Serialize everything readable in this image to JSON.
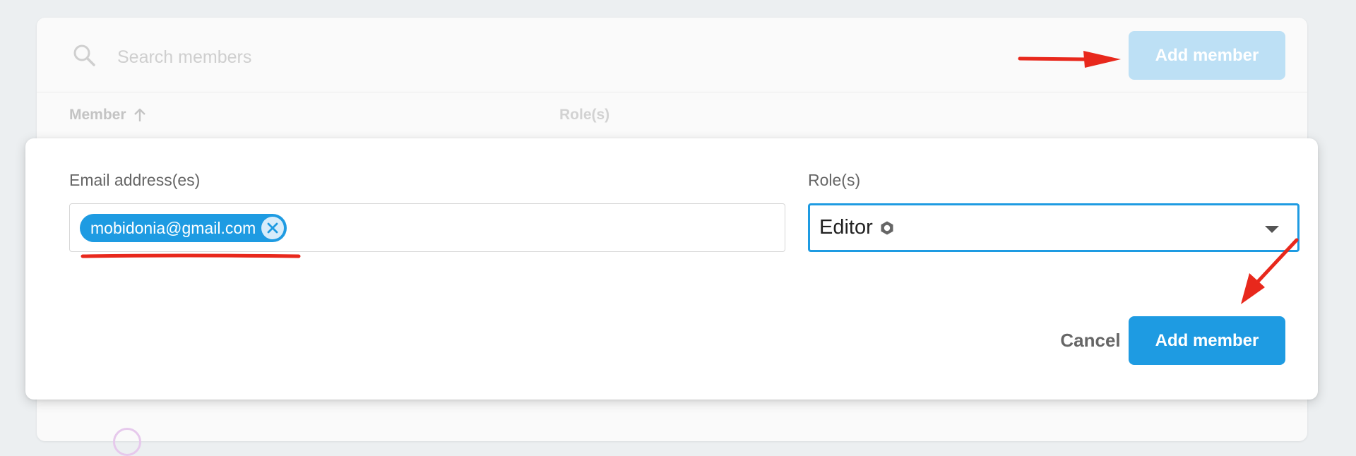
{
  "search": {
    "placeholder": "Search members",
    "icon": "search-icon"
  },
  "toolbar": {
    "add_member_label": "Add member"
  },
  "table": {
    "columns": [
      {
        "label": "Member",
        "sort": "ascending",
        "sort_icon": "arrow-up-icon"
      },
      {
        "label": "Role(s)"
      }
    ]
  },
  "dialog": {
    "email_label": "Email address(es)",
    "emails": [
      {
        "value": "mobidonia@gmail.com",
        "remove_icon": "close-circle-icon"
      }
    ],
    "roles_label": "Role(s)",
    "role_value": "Editor",
    "role_icon": "settings-badge-icon",
    "dropdown_icon": "caret-down-icon",
    "cancel_label": "Cancel",
    "add_member_label": "Add member"
  },
  "colors": {
    "accent": "#1e9be2",
    "accent_disabled": "#bde0f5",
    "annotation": "#e8281c"
  }
}
